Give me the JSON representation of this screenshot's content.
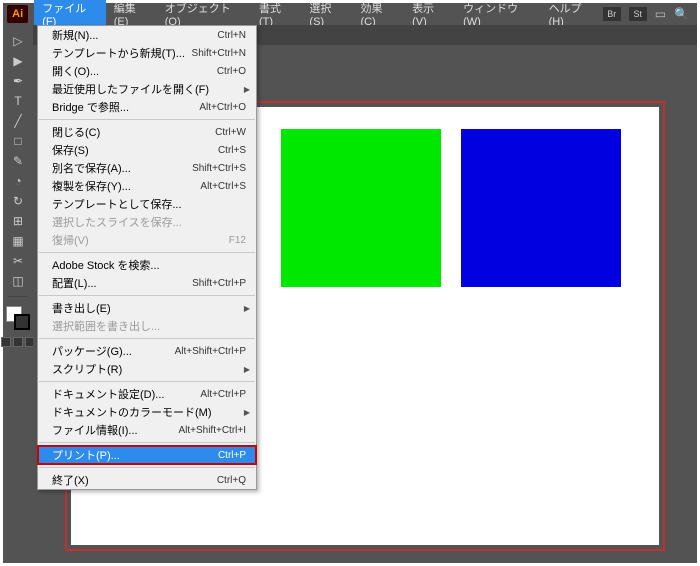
{
  "app_icon": "Ai",
  "menubar": {
    "items": [
      {
        "label": "ファイル(F)",
        "active": true
      },
      {
        "label": "編集(E)"
      },
      {
        "label": "オブジェクト(O)"
      },
      {
        "label": "書式(T)"
      },
      {
        "label": "選択(S)"
      },
      {
        "label": "効果(C)"
      },
      {
        "label": "表示(V)"
      },
      {
        "label": "ウィンドウ(W)"
      },
      {
        "label": "ヘルプ(H)"
      }
    ],
    "badges": [
      "Br",
      "St"
    ]
  },
  "tools": [
    "▷",
    "▶",
    "✒",
    "T",
    "╱",
    "□",
    "✎",
    "◔",
    "↻",
    "⊞",
    "▦",
    "✂",
    "◫"
  ],
  "file_menu": [
    {
      "label": "新規(N)...",
      "shortcut": "Ctrl+N"
    },
    {
      "label": "テンプレートから新規(T)...",
      "shortcut": "Shift+Ctrl+N"
    },
    {
      "label": "開く(O)...",
      "shortcut": "Ctrl+O"
    },
    {
      "label": "最近使用したファイルを開く(F)",
      "sub": true
    },
    {
      "label": "Bridge で参照...",
      "shortcut": "Alt+Ctrl+O"
    },
    {
      "sep": true
    },
    {
      "label": "閉じる(C)",
      "shortcut": "Ctrl+W"
    },
    {
      "label": "保存(S)",
      "shortcut": "Ctrl+S"
    },
    {
      "label": "別名で保存(A)...",
      "shortcut": "Shift+Ctrl+S"
    },
    {
      "label": "複製を保存(Y)...",
      "shortcut": "Alt+Ctrl+S"
    },
    {
      "label": "テンプレートとして保存..."
    },
    {
      "label": "選択したスライスを保存...",
      "disabled": true
    },
    {
      "label": "復帰(V)",
      "shortcut": "F12",
      "disabled": true
    },
    {
      "sep": true
    },
    {
      "label": "Adobe Stock を検索..."
    },
    {
      "label": "配置(L)...",
      "shortcut": "Shift+Ctrl+P"
    },
    {
      "sep": true
    },
    {
      "label": "書き出し(E)",
      "sub": true
    },
    {
      "label": "選択範囲を書き出し...",
      "disabled": true
    },
    {
      "sep": true
    },
    {
      "label": "パッケージ(G)...",
      "shortcut": "Alt+Shift+Ctrl+P"
    },
    {
      "label": "スクリプト(R)",
      "sub": true
    },
    {
      "sep": true
    },
    {
      "label": "ドキュメント設定(D)...",
      "shortcut": "Alt+Ctrl+P"
    },
    {
      "label": "ドキュメントのカラーモード(M)",
      "sub": true
    },
    {
      "label": "ファイル情報(I)...",
      "shortcut": "Alt+Shift+Ctrl+I"
    },
    {
      "sep": true
    },
    {
      "label": "プリント(P)...",
      "shortcut": "Ctrl+P",
      "highlight": true,
      "boxed": true
    },
    {
      "sep": true
    },
    {
      "label": "終了(X)",
      "shortcut": "Ctrl+Q"
    }
  ],
  "canvas": {
    "green": "#00e800",
    "blue": "#0000e0"
  }
}
